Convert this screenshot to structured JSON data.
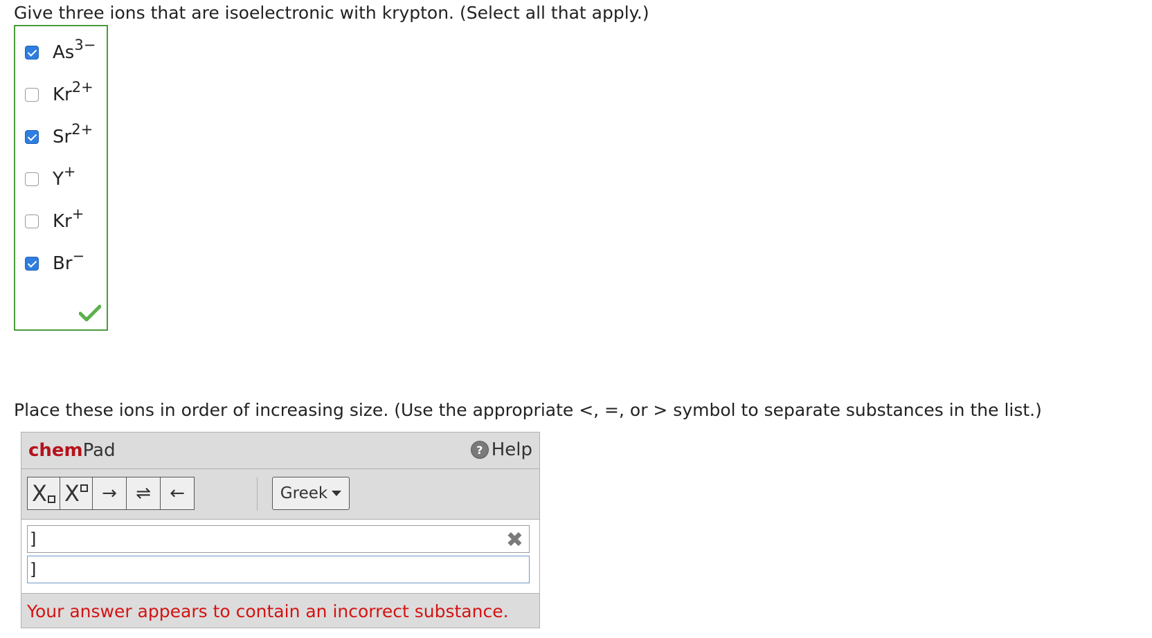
{
  "question1": {
    "text": "Give three ions that are isoelectronic with krypton. (Select all that apply.)",
    "choices": [
      {
        "symbol": "As",
        "charge": "3−",
        "checked": true
      },
      {
        "symbol": "Kr",
        "charge": "2+",
        "checked": false
      },
      {
        "symbol": "Sr",
        "charge": "2+",
        "checked": true
      },
      {
        "symbol": "Y",
        "charge": "+",
        "checked": false
      },
      {
        "symbol": "Kr",
        "charge": "+",
        "checked": false
      },
      {
        "symbol": "Br",
        "charge": "−",
        "checked": true
      }
    ],
    "result_icon": "green-checkmark-icon"
  },
  "question2": {
    "text": "Place these ions in order of increasing size. (Use the appropriate <, =, or > symbol to separate substances in the list.)"
  },
  "chempad": {
    "brand_bold": "chem",
    "brand_rest": "Pad",
    "help_label": "Help",
    "help_icon": "?",
    "toolbar": {
      "subscript_label": "X",
      "superscript_label": "X",
      "arrow_right": "→",
      "equilibrium": "⇌",
      "arrow_left": "←",
      "greek_label": "Greek"
    },
    "field1_value": "]",
    "field2_value": "]",
    "clear_icon": "✖",
    "status": "Your answer appears to contain an incorrect substance."
  },
  "colors": {
    "correct_border": "#4a9a3a",
    "checkbox_checked": "#2f7ee0",
    "brand_red": "#b5121b",
    "error_red": "#d41313"
  }
}
